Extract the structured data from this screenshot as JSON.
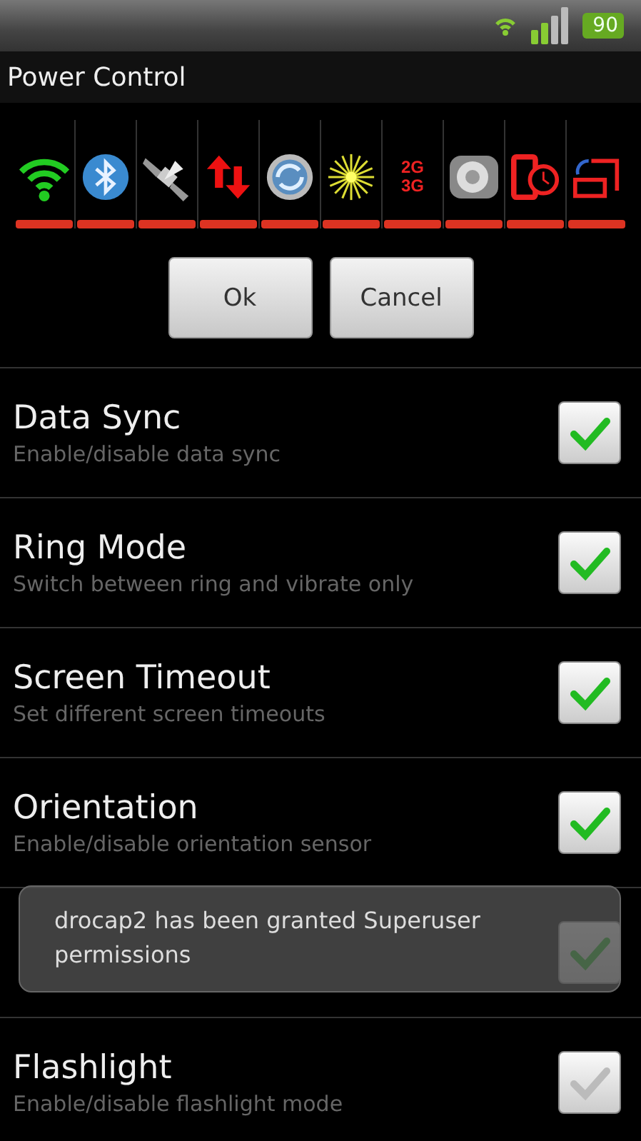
{
  "status_bar": {
    "battery": "90"
  },
  "window": {
    "title": "Power Control"
  },
  "toggles": [
    {
      "kind": "wifi",
      "on": false
    },
    {
      "kind": "bluetooth",
      "on": false
    },
    {
      "kind": "gps",
      "on": false
    },
    {
      "kind": "data",
      "on": false
    },
    {
      "kind": "sync",
      "on": false
    },
    {
      "kind": "brightness",
      "on": false
    },
    {
      "kind": "network",
      "on": false,
      "label_top": "2G",
      "label_bottom": "3G"
    },
    {
      "kind": "sound",
      "on": false
    },
    {
      "kind": "timeout",
      "on": false
    },
    {
      "kind": "rotation",
      "on": false
    }
  ],
  "buttons": [
    "Ok",
    "Cancel"
  ],
  "settings": [
    {
      "title": "Data Sync",
      "subtitle": "Enable/disable data sync",
      "checked": true
    },
    {
      "title": "Ring Mode",
      "subtitle": "Switch between ring and vibrate only",
      "checked": true
    },
    {
      "title": "Screen Timeout",
      "subtitle": "Set different screen timeouts",
      "checked": true
    },
    {
      "title": "Orientation",
      "subtitle": "Enable/disable orientation sensor",
      "checked": true
    },
    {
      "checked": true
    },
    {
      "title": "Flashlight",
      "subtitle": "Enable/disable flashlight mode",
      "checked": false
    }
  ],
  "toast": {
    "message": "drocap2 has been granted Superuser permissions"
  }
}
